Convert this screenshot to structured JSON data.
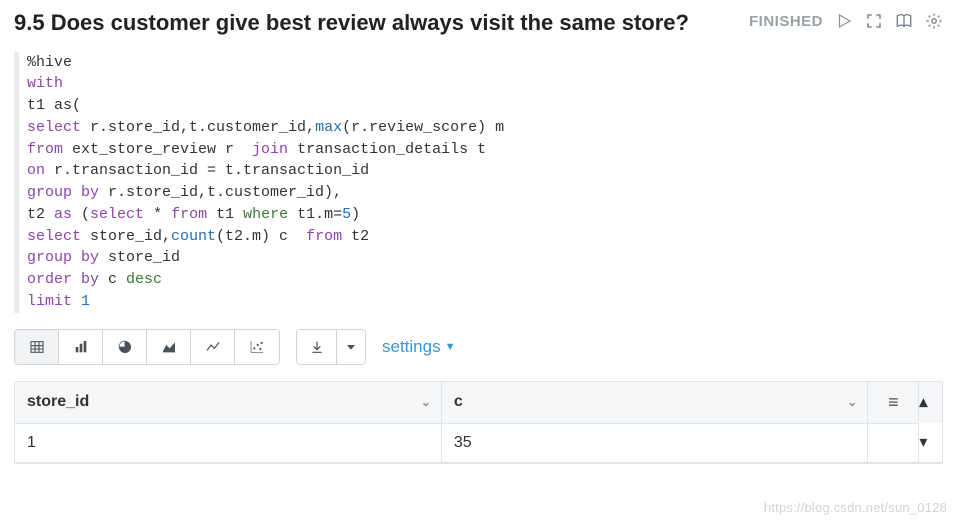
{
  "header": {
    "title": "9.5 Does customer give best review always visit the same store?",
    "status": "FINISHED"
  },
  "code": {
    "lines": [
      {
        "t": [
          {
            "c": "plain",
            "v": "%hive"
          }
        ]
      },
      {
        "t": [
          {
            "c": "kw",
            "v": "with"
          }
        ]
      },
      {
        "t": [
          {
            "c": "plain",
            "v": "t1 as("
          }
        ]
      },
      {
        "t": [
          {
            "c": "kw",
            "v": "select"
          },
          {
            "c": "plain",
            "v": " r.store_id,t.customer_id,"
          },
          {
            "c": "fn",
            "v": "max"
          },
          {
            "c": "plain",
            "v": "(r.review_score) m"
          }
        ]
      },
      {
        "t": [
          {
            "c": "kw",
            "v": "from"
          },
          {
            "c": "plain",
            "v": " ext_store_review r  "
          },
          {
            "c": "kw",
            "v": "join"
          },
          {
            "c": "plain",
            "v": " transaction_details t"
          }
        ]
      },
      {
        "t": [
          {
            "c": "kw",
            "v": "on"
          },
          {
            "c": "plain",
            "v": " r.transaction_id = t.transaction_id"
          }
        ]
      },
      {
        "t": [
          {
            "c": "kw",
            "v": "group by"
          },
          {
            "c": "plain",
            "v": " r.store_id,t.customer_id),"
          }
        ]
      },
      {
        "t": [
          {
            "c": "plain",
            "v": "t2 "
          },
          {
            "c": "kw",
            "v": "as"
          },
          {
            "c": "plain",
            "v": " ("
          },
          {
            "c": "kw",
            "v": "select"
          },
          {
            "c": "plain",
            "v": " * "
          },
          {
            "c": "kw",
            "v": "from"
          },
          {
            "c": "plain",
            "v": " t1 "
          },
          {
            "c": "ns",
            "v": "where"
          },
          {
            "c": "plain",
            "v": " t1.m="
          },
          {
            "c": "num",
            "v": "5"
          },
          {
            "c": "plain",
            "v": ")"
          }
        ]
      },
      {
        "t": [
          {
            "c": "kw",
            "v": "select"
          },
          {
            "c": "plain",
            "v": " store_id,"
          },
          {
            "c": "fn",
            "v": "count"
          },
          {
            "c": "plain",
            "v": "(t2.m) c  "
          },
          {
            "c": "kw",
            "v": "from"
          },
          {
            "c": "plain",
            "v": " t2"
          }
        ]
      },
      {
        "t": [
          {
            "c": "kw",
            "v": "group by"
          },
          {
            "c": "plain",
            "v": " store_id"
          }
        ]
      },
      {
        "t": [
          {
            "c": "kw",
            "v": "order by"
          },
          {
            "c": "plain",
            "v": " c "
          },
          {
            "c": "ns",
            "v": "desc"
          }
        ]
      },
      {
        "t": [
          {
            "c": "kw",
            "v": "limit"
          },
          {
            "c": "plain",
            "v": " "
          },
          {
            "c": "num",
            "v": "1"
          }
        ]
      }
    ]
  },
  "toolbar": {
    "settings_label": "settings"
  },
  "results": {
    "columns": [
      "store_id",
      "c"
    ],
    "rows": [
      {
        "store_id": "1",
        "c": "35"
      }
    ]
  },
  "watermark": "https://blog.csdn.net/sun_0128"
}
